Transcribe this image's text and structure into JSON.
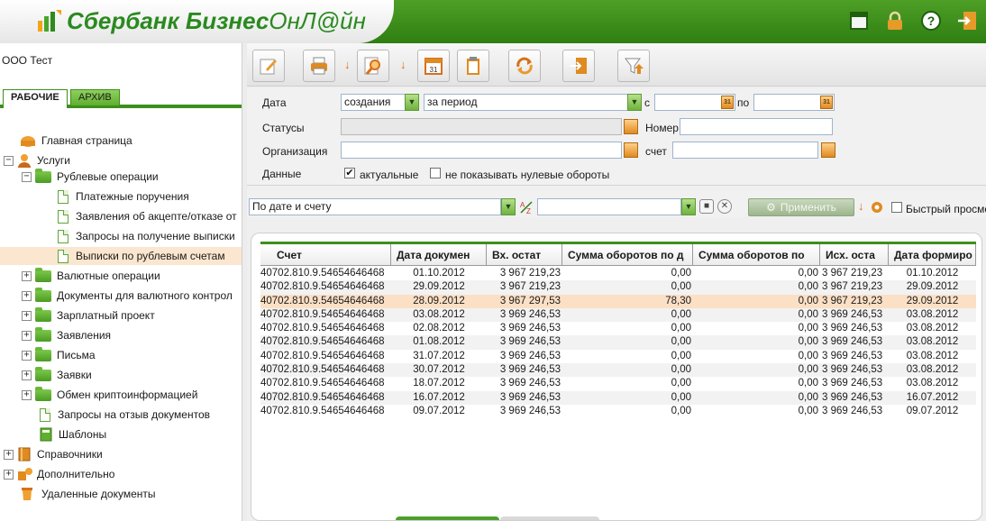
{
  "brand": {
    "name_bold": "Сбербанк Бизнес",
    "name_light": "ОнЛ@йн",
    "accent": "#2f8a1c"
  },
  "header_icons": [
    "window-icon",
    "lock-icon",
    "help-icon",
    "exit-icon"
  ],
  "org": "ООО Тест",
  "tabs": {
    "active": "РАБОЧИЕ",
    "inactive": "АРХИВ"
  },
  "tree": {
    "home": "Главная страница",
    "services": "Услуги",
    "rub_ops": "Рублевые операции",
    "rub_children": [
      "Платежные поручения",
      "Заявления об акцепте/отказе от",
      "Запросы на получение выписки",
      "Выписки по рублевым счетам"
    ],
    "folders": [
      "Валютные операции",
      "Документы для валютного контрол",
      "Зарплатный проект",
      "Заявления",
      "Письма",
      "Заявки",
      "Обмен криптоинформацией"
    ],
    "revoke": "Запросы на отзыв документов",
    "templates": "Шаблоны",
    "refs": "Справочники",
    "extra": "Дополнительно",
    "deleted": "Удаленные документы"
  },
  "filters": {
    "date_label": "Дата",
    "date_type": "создания",
    "period": "за период",
    "from_label": "с",
    "to_label": "по",
    "statuses_label": "Статусы",
    "number_label": "Номер",
    "org_label": "Организация",
    "account_label": "счет",
    "data_label": "Данные",
    "actual_label": "актуальные",
    "actual_checked": "✔",
    "zero_label": "не показывать нулевые обороты"
  },
  "sort": {
    "selected": "По дате и счету",
    "apply": "Применить",
    "quick_view": "Быстрый просмо"
  },
  "grid": {
    "headers": [
      "Счет",
      "Дата докумен",
      "Вх. остат",
      "Сумма оборотов по д",
      "Сумма оборотов по",
      "Исх. оста",
      "Дата формиро"
    ],
    "rows": [
      [
        "40702.810.9.54654646468",
        "01.10.2012",
        "3 967 219,23",
        "0,00",
        "0,00",
        "3 967 219,23",
        "01.10.2012"
      ],
      [
        "40702.810.9.54654646468",
        "29.09.2012",
        "3 967 219,23",
        "0,00",
        "0,00",
        "3 967 219,23",
        "29.09.2012"
      ],
      [
        "40702.810.9.54654646468",
        "28.09.2012",
        "3 967 297,53",
        "78,30",
        "0,00",
        "3 967 219,23",
        "29.09.2012"
      ],
      [
        "40702.810.9.54654646468",
        "03.08.2012",
        "3 969 246,53",
        "0,00",
        "0,00",
        "3 969 246,53",
        "03.08.2012"
      ],
      [
        "40702.810.9.54654646468",
        "02.08.2012",
        "3 969 246,53",
        "0,00",
        "0,00",
        "3 969 246,53",
        "03.08.2012"
      ],
      [
        "40702.810.9.54654646468",
        "01.08.2012",
        "3 969 246,53",
        "0,00",
        "0,00",
        "3 969 246,53",
        "03.08.2012"
      ],
      [
        "40702.810.9.54654646468",
        "31.07.2012",
        "3 969 246,53",
        "0,00",
        "0,00",
        "3 969 246,53",
        "03.08.2012"
      ],
      [
        "40702.810.9.54654646468",
        "30.07.2012",
        "3 969 246,53",
        "0,00",
        "0,00",
        "3 969 246,53",
        "03.08.2012"
      ],
      [
        "40702.810.9.54654646468",
        "18.07.2012",
        "3 969 246,53",
        "0,00",
        "0,00",
        "3 969 246,53",
        "03.08.2012"
      ],
      [
        "40702.810.9.54654646468",
        "16.07.2012",
        "3 969 246,53",
        "0,00",
        "0,00",
        "3 969 246,53",
        "16.07.2012"
      ],
      [
        "40702.810.9.54654646468",
        "09.07.2012",
        "3 969 246,53",
        "0,00",
        "0,00",
        "3 969 246,53",
        "09.07.2012"
      ]
    ],
    "highlight_row": 2
  }
}
